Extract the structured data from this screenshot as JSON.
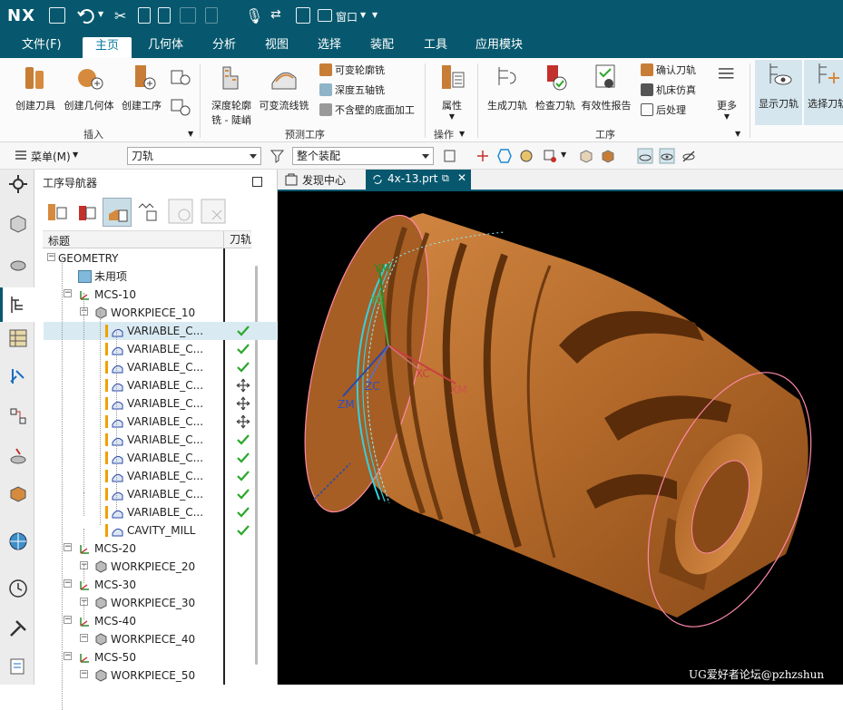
{
  "app": {
    "logo": "NX",
    "window_menu": "窗口"
  },
  "menubar": {
    "items": [
      "文件(F)",
      "主页",
      "几何体",
      "分析",
      "视图",
      "选择",
      "装配",
      "工具",
      "应用模块"
    ],
    "active": "主页"
  },
  "ribbon": {
    "insert": {
      "label": "插入",
      "buttons": [
        "创建刀具",
        "创建几何体",
        "创建工序"
      ]
    },
    "predefined": {
      "label": "预测工序",
      "btn1": "深度轮廓",
      "btn1b": "铣 - 陡峭",
      "btn2": "可变流线铣",
      "small": [
        "可变轮廓铣",
        "深度五轴铣",
        "不含壁的底面加工"
      ]
    },
    "operation": {
      "label": "操作",
      "btn": "属性"
    },
    "process": {
      "label": "工序",
      "buttons": [
        "生成刀轨",
        "检查刀轨",
        "有效性报告"
      ],
      "small": [
        "确认刀轨",
        "机床仿真",
        "后处理"
      ],
      "more": "更多"
    },
    "display": {
      "buttons": [
        "显示刀轨",
        "选择刀轨"
      ]
    }
  },
  "toolbar2": {
    "menu": "菜单(M)",
    "filter": "刀轨",
    "scope": "整个装配"
  },
  "navigator": {
    "title": "工序导航器",
    "col_title": "标题",
    "col_path": "刀轨",
    "rows": [
      {
        "label": "GEOMETRY",
        "status": ""
      },
      {
        "label": "未用项",
        "status": ""
      },
      {
        "label": "MCS-10",
        "status": ""
      },
      {
        "label": "WORKPIECE_10",
        "status": ""
      },
      {
        "label": "VARIABLE_C...",
        "status": "check"
      },
      {
        "label": "VARIABLE_C...",
        "status": "check"
      },
      {
        "label": "VARIABLE_C...",
        "status": "check"
      },
      {
        "label": "VARIABLE_C...",
        "status": "move"
      },
      {
        "label": "VARIABLE_C...",
        "status": "move"
      },
      {
        "label": "VARIABLE_C...",
        "status": "move"
      },
      {
        "label": "VARIABLE_C...",
        "status": "check"
      },
      {
        "label": "VARIABLE_C...",
        "status": "check"
      },
      {
        "label": "VARIABLE_C...",
        "status": "check"
      },
      {
        "label": "VARIABLE_C...",
        "status": "check"
      },
      {
        "label": "VARIABLE_C...",
        "status": "check"
      },
      {
        "label": "CAVITY_MILL",
        "status": "check"
      },
      {
        "label": "MCS-20",
        "status": ""
      },
      {
        "label": "WORKPIECE_20",
        "status": ""
      },
      {
        "label": "MCS-30",
        "status": ""
      },
      {
        "label": "WORKPIECE_30",
        "status": ""
      },
      {
        "label": "MCS-40",
        "status": ""
      },
      {
        "label": "WORKPIECE_40",
        "status": ""
      },
      {
        "label": "MCS-50",
        "status": ""
      },
      {
        "label": "WORKPIECE_50",
        "status": ""
      }
    ]
  },
  "tabs": {
    "tab1": "发现中心",
    "tab2": "4x-13.prt"
  },
  "viewport": {
    "axis_labels": [
      "YM",
      "YC",
      "ZC",
      "ZM",
      "XC",
      "XM"
    ],
    "watermark": "UG爱好者论坛@pzhzshun"
  },
  "colors": {
    "brand": "#07586e",
    "part": "#b66a2c",
    "toolpath": "#35d0e0",
    "check": "#2aa82a"
  }
}
